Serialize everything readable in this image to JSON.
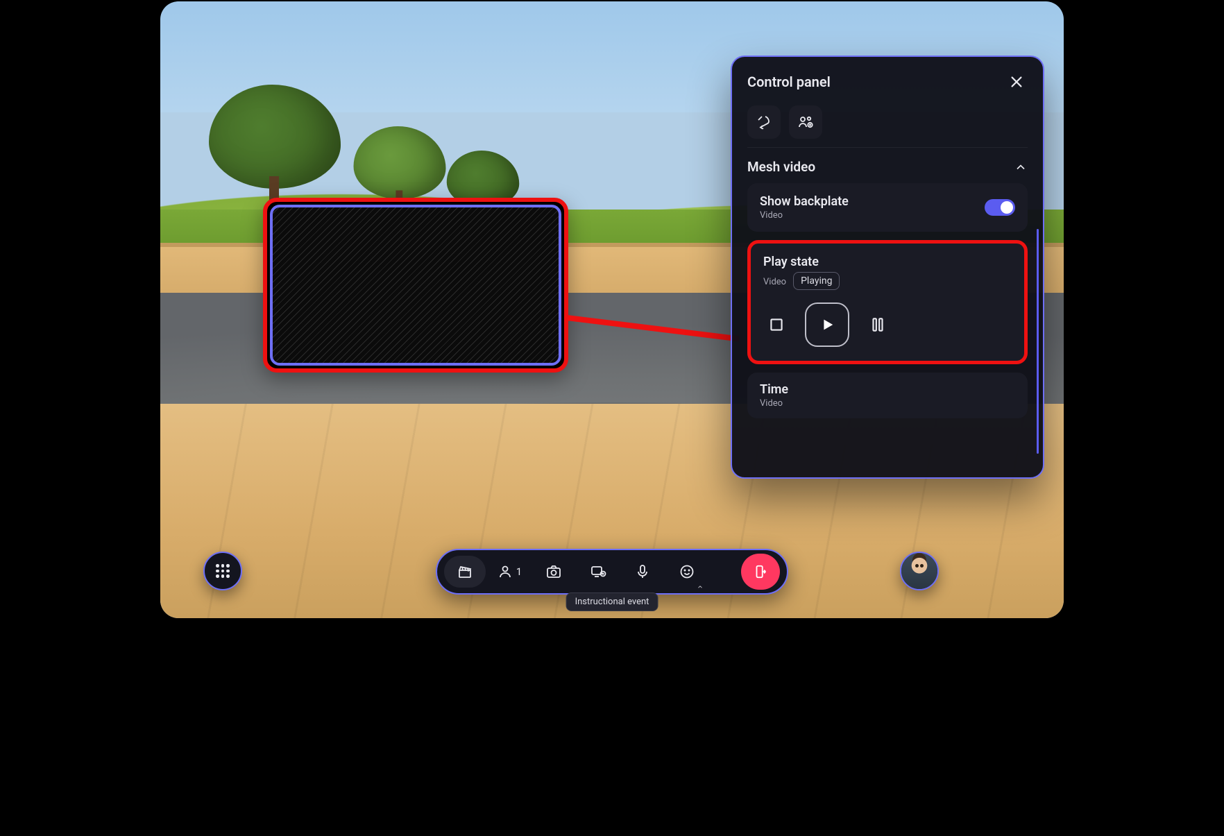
{
  "panel": {
    "title": "Control panel",
    "section": {
      "title": "Mesh video"
    },
    "backplate": {
      "title": "Show backplate",
      "sub": "Video",
      "enabled": true
    },
    "playstate": {
      "title": "Play state",
      "sub": "Video",
      "status": "Playing"
    },
    "time": {
      "title": "Time",
      "sub": "Video"
    }
  },
  "toolbar": {
    "people_count": "1",
    "tooltip": "Instructional event"
  }
}
